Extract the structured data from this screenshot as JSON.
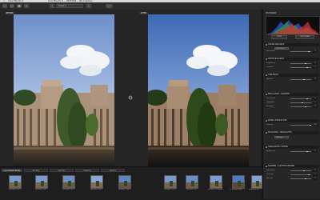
{
  "menubar": {
    "app": "Color Efex Pro 4",
    "file": "Palace_of_Fine_Arts.tif",
    "window": "Color Efex Pro 4 — DSCF6345 — Nik Collection"
  },
  "toolbar": {
    "zoom_label": "Fit",
    "dropdown_label": "Preset ▾"
  },
  "viewer": {
    "before_label": "BEFORE",
    "after_label": "AFTER"
  },
  "sidebar": {
    "histogram_title": "HISTOGRAM",
    "tab_loupe": "LOUPE",
    "tab_histogram": "HISTOGRAM",
    "sections": [
      {
        "title": "COLOR BALANCE"
      },
      {
        "title": "WHITE BALANCE"
      },
      {
        "title": "CONTRAST"
      },
      {
        "title": "BRILLIANCE / WARMTH"
      },
      {
        "title": "DETAIL EXTRACTOR"
      },
      {
        "title": "SHADOWS / HIGHLIGHTS"
      },
      {
        "title": "GRADUATED FILTERS"
      },
      {
        "title": "DARKEN / LIGHTEN CENTER"
      }
    ],
    "rows": [
      {
        "label": "Saturation",
        "value": "0"
      },
      {
        "label": "Brightness",
        "value": "0"
      },
      {
        "label": "Contrast",
        "value": "0"
      },
      {
        "label": "Warmth",
        "value": "0"
      },
      {
        "label": "Perceptual",
        "value": "0"
      },
      {
        "label": "Highlights",
        "value": "0"
      },
      {
        "label": "Shadows",
        "value": "0"
      },
      {
        "label": "Opacity",
        "value": "100"
      }
    ],
    "selects": [
      "Cool Preset ▾",
      "Opacity ▾"
    ]
  },
  "filmstrip": {
    "tabs": [
      "COLOR EFEX FILTERS",
      "RECIPES",
      "HISTORY",
      "PRESETS",
      "RESETS"
    ],
    "thumbs": [
      "Cyn Ivelo** 100",
      "Cyn Ivelo** 100",
      "Cyn Ivelo** 100",
      "Cyn Ivelo** 2017",
      "Cyn Ivelo** 2030",
      "Cyn Ivelo** 12G",
      "Cyn Ivelo** 50",
      "Cyn Ivelo** 50 Modern",
      "Detail Ratio Vivid***",
      "Modo Ratio 100"
    ]
  },
  "colors": {
    "accent": "#f0a030",
    "panel": "#262626",
    "sky": "#8ba7d8"
  }
}
